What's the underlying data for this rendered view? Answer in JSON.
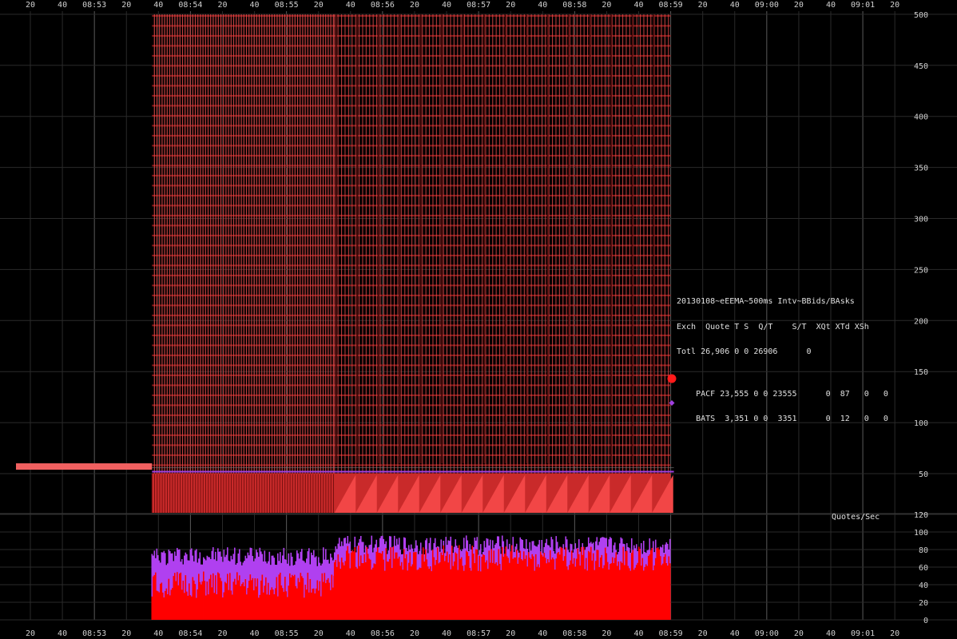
{
  "chart_data": [
    {
      "type": "line",
      "title": "20130108~eEEMA~500ms Intv~BBids/BAsks",
      "y_ticks": [
        50,
        100,
        150,
        200,
        250,
        300,
        350,
        400,
        450,
        500
      ],
      "ylim": [
        20,
        500
      ],
      "grid": true,
      "x_tick_labels": [
        "20",
        "40",
        "08:53",
        "20",
        "40",
        "08:54",
        "20",
        "40",
        "08:55",
        "20",
        "40",
        "08:56",
        "20",
        "40",
        "08:57",
        "20",
        "40",
        "08:58",
        "20",
        "40",
        "08:59",
        "20",
        "40",
        "09:00",
        "20",
        "40",
        "09:01",
        "20"
      ],
      "x_start_seconds": 20,
      "x_step_seconds": 20,
      "data_x_range_seconds": [
        96,
        420
      ],
      "series": [
        {
          "name": "PACF",
          "color": "#ff3030",
          "baseline_before": 57,
          "low": 20,
          "high": 500
        },
        {
          "name": "BATS",
          "color": "#a040e0",
          "level": 52
        }
      ],
      "legend": {
        "columns": "Exch  Quote T S  Q/T    S/T  XQt XTd XSh",
        "rows": [
          {
            "label": "Totl 26,906 0 0 26906      0",
            "marker": ""
          },
          {
            "label": "PACF 23,555 0 0 23555      0  87   0   0",
            "marker": "red-dot"
          },
          {
            "label": "BATS  3,351 0 0  3351      0  12   0   0",
            "marker": "purple-diamond"
          }
        ]
      }
    },
    {
      "type": "bar",
      "title": "Quotes/Sec",
      "y_ticks": [
        0,
        20,
        40,
        60,
        80,
        100,
        120
      ],
      "ylim": [
        0,
        120
      ],
      "grid": true,
      "series": [
        {
          "name": "PACF",
          "color": "#ff0000",
          "segments": [
            {
              "x_range_seconds": [
                96,
                210
              ],
              "level": 40
            },
            {
              "x_range_seconds": [
                210,
                420
              ],
              "level": 70
            }
          ]
        },
        {
          "name": "BATS",
          "color": "#b040f0",
          "segments": [
            {
              "x_range_seconds": [
                96,
                210
              ],
              "level": 72
            },
            {
              "x_range_seconds": [
                210,
                420
              ],
              "level": 85
            }
          ]
        }
      ]
    }
  ]
}
